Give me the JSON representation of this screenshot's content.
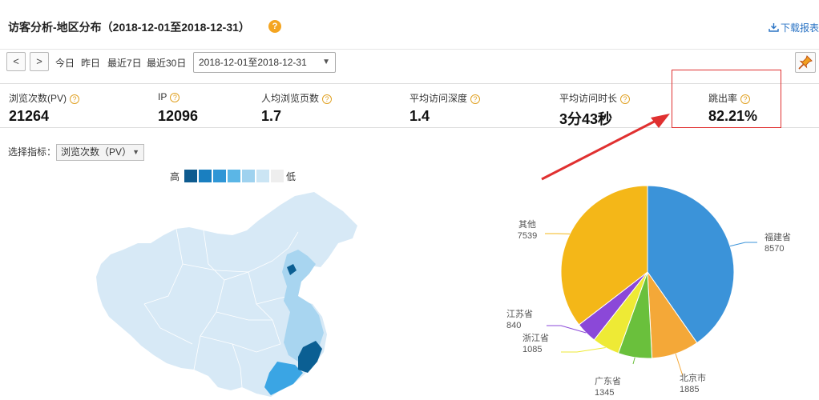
{
  "header": {
    "title": "访客分析-地区分布（2018-12-01至2018-12-31）",
    "help": "?",
    "download_label": "下载报表"
  },
  "toolbar": {
    "prev": "<",
    "next": ">",
    "today": "今日",
    "yesterday": "昨日",
    "last7": "最近7日",
    "last30": "最近30日",
    "date_range": "2018-12-01至2018-12-31"
  },
  "metrics": [
    {
      "label": "浏览次数(PV)",
      "value": "21264"
    },
    {
      "label": "IP",
      "value": "12096"
    },
    {
      "label": "人均浏览页数",
      "value": "1.7"
    },
    {
      "label": "平均访问深度",
      "value": "1.4"
    },
    {
      "label": "平均访问时长",
      "value": "3分43秒"
    },
    {
      "label": "跳出率",
      "value": "82.21%"
    }
  ],
  "selector": {
    "label": "选择指标：",
    "value": "浏览次数（PV）"
  },
  "legend": {
    "high": "高",
    "low": "低",
    "colors": [
      "#0e5b8f",
      "#1a7fc0",
      "#2f96d6",
      "#5bb6e6",
      "#9fd2ef",
      "#cbe5f4",
      "#eeeeee"
    ]
  },
  "colors": {
    "map_base": "#d7e9f6",
    "map_light": "#a8d5f0",
    "map_mid": "#3aa5e4",
    "map_dark": "#0b5f93",
    "accent": "#e03030"
  },
  "chart_data": {
    "type": "pie",
    "series": [
      {
        "label": "福建省",
        "value": 8570,
        "color": "#3b93d9"
      },
      {
        "label": "北京市",
        "value": 1885,
        "color": "#f4a838"
      },
      {
        "label": "广东省",
        "value": 1345,
        "color": "#6ac03c"
      },
      {
        "label": "浙江省",
        "value": 1085,
        "color": "#eeea35"
      },
      {
        "label": "江苏省",
        "value": 840,
        "color": "#8b48d8"
      },
      {
        "label": "其他",
        "value": 7539,
        "color": "#f4b718"
      }
    ]
  }
}
